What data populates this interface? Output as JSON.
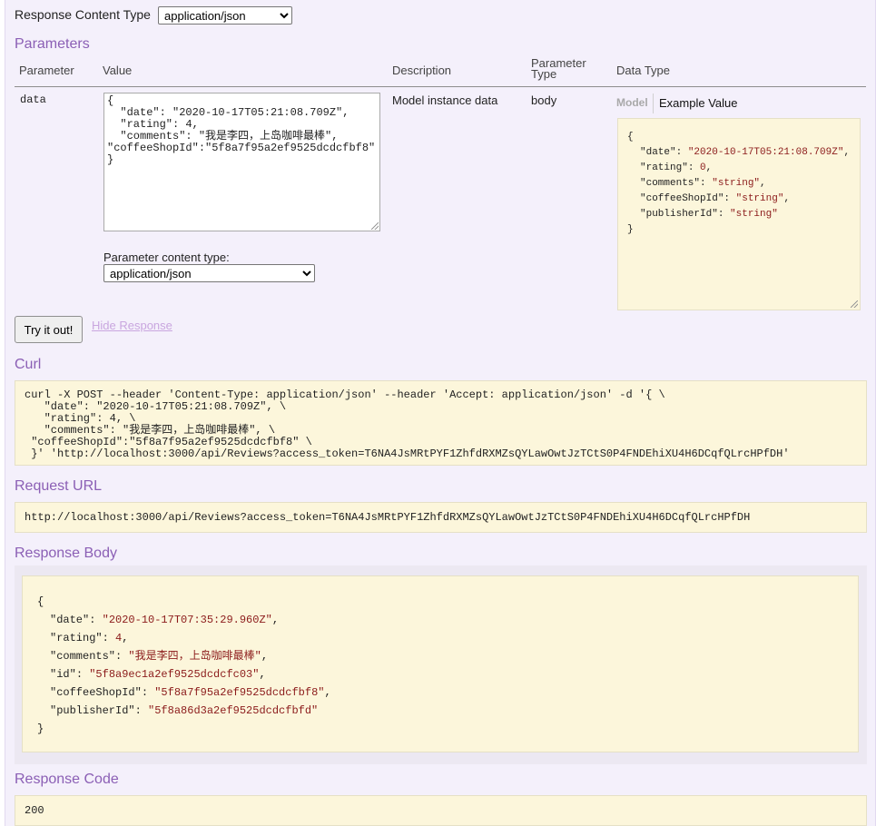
{
  "response_content_type": {
    "label": "Response Content Type",
    "selected": "application/json"
  },
  "parameters": {
    "heading": "Parameters",
    "columns": {
      "parameter": "Parameter",
      "value": "Value",
      "description": "Description",
      "parameter_type": "Parameter Type",
      "data_type": "Data Type"
    },
    "row": {
      "name": "data",
      "value": "{\n  \"date\": \"2020-10-17T05:21:08.709Z\",\n  \"rating\": 4,\n  \"comments\": \"我是李四，上岛咖啡最棒\",\n\"coffeeShopId\":\"5f8a7f95a2ef9525dcdcfbf8\"\n}",
      "description": "Model instance data",
      "param_type": "body",
      "content_type_label": "Parameter content type:",
      "content_type_selected": "application/json"
    },
    "data_type": {
      "tab_model": "Model",
      "tab_example": "Example Value",
      "example": {
        "open": "{",
        "lines": [
          {
            "key": "\"date\"",
            "val": "\"2020-10-17T05:21:08.709Z\"",
            "tail": ","
          },
          {
            "key": "\"rating\"",
            "val": "0",
            "tail": ","
          },
          {
            "key": "\"comments\"",
            "val": "\"string\"",
            "tail": ","
          },
          {
            "key": "\"coffeeShopId\"",
            "val": "\"string\"",
            "tail": ","
          },
          {
            "key": "\"publisherId\"",
            "val": "\"string\"",
            "tail": ""
          }
        ],
        "close": "}"
      }
    }
  },
  "actions": {
    "try_label": "Try it out!",
    "hide_label": "Hide Response"
  },
  "curl": {
    "heading": "Curl",
    "text": "curl -X POST --header 'Content-Type: application/json' --header 'Accept: application/json' -d '{ \\\n   \"date\": \"2020-10-17T05:21:08.709Z\", \\\n   \"rating\": 4, \\\n   \"comments\": \"我是李四，上岛咖啡最棒\", \\\n \"coffeeShopId\":\"5f8a7f95a2ef9525dcdcfbf8\" \\\n }' 'http://localhost:3000/api/Reviews?access_token=T6NA4JsMRtPYF1ZhfdRXMZsQYLawOwtJzTCtS0P4FNDEhiXU4H6DCqfQLrcHPfDH'"
  },
  "request_url": {
    "heading": "Request URL",
    "text": "http://localhost:3000/api/Reviews?access_token=T6NA4JsMRtPYF1ZhfdRXMZsQYLawOwtJzTCtS0P4FNDEhiXU4H6DCqfQLrcHPfDH"
  },
  "response_body": {
    "heading": "Response Body",
    "open": "{",
    "lines": [
      {
        "key": "\"date\"",
        "val": "\"2020-10-17T07:35:29.960Z\"",
        "tail": ","
      },
      {
        "key": "\"rating\"",
        "val": "4",
        "tail": ","
      },
      {
        "key": "\"comments\"",
        "val": "\"我是李四，上岛咖啡最棒\"",
        "tail": ","
      },
      {
        "key": "\"id\"",
        "val": "\"5f8a9ec1a2ef9525dcdcfc03\"",
        "tail": ","
      },
      {
        "key": "\"coffeeShopId\"",
        "val": "\"5f8a7f95a2ef9525dcdcfbf8\"",
        "tail": ","
      },
      {
        "key": "\"publisherId\"",
        "val": "\"5f8a86d3a2ef9525dcdcfbfd\"",
        "tail": ""
      }
    ],
    "close": "}"
  },
  "response_code": {
    "heading": "Response Code",
    "text": "200"
  },
  "colors": {
    "heading": "#8b5fb5",
    "panel_bg": "#f4f0fb",
    "code_bg": "#fcf6db",
    "string_value": "#8b1a1a",
    "link": "#c9a6df"
  }
}
